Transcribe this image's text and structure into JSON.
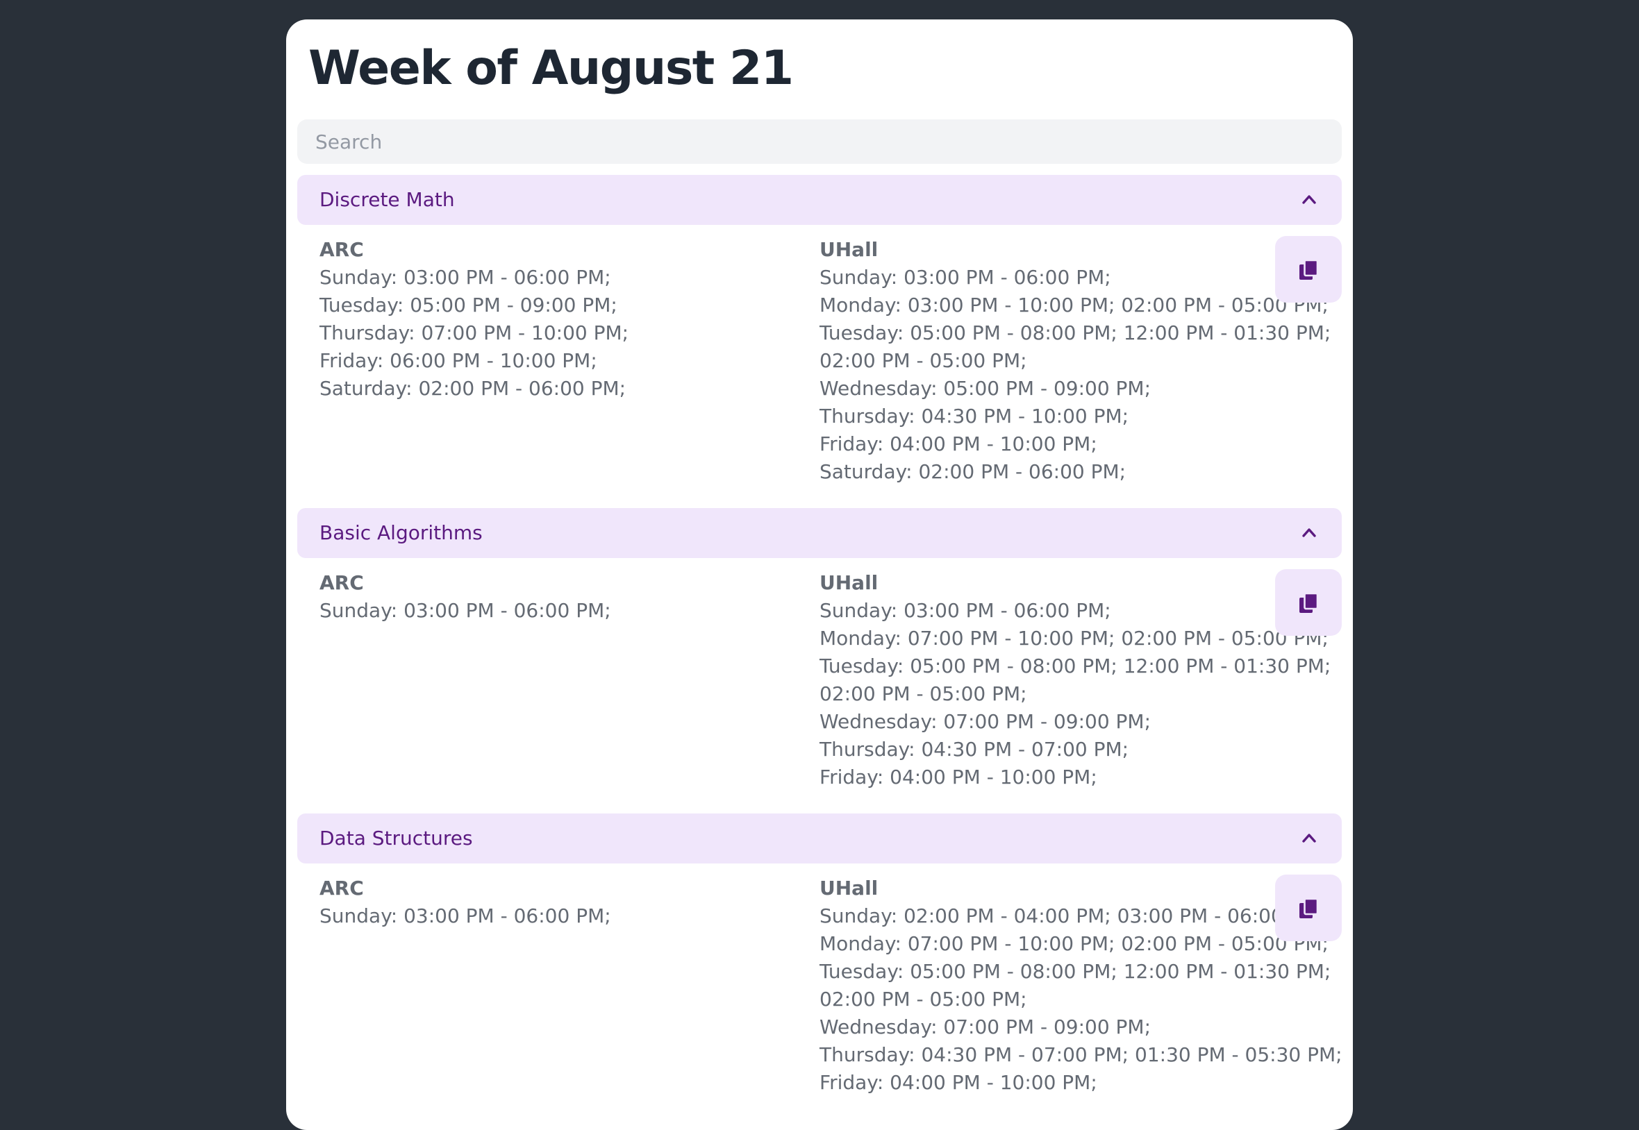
{
  "page": {
    "title": "Week of August 21",
    "search_placeholder": "Search"
  },
  "colors": {
    "background": "#293039",
    "card": "#ffffff",
    "accent": "#5b1a80",
    "accent_soft": "#f0e6fb",
    "text": "#646a73",
    "title": "#1e2733"
  },
  "icons": {
    "copy": "copy-icon",
    "collapse": "chevron-up-icon"
  },
  "courses": [
    {
      "name": "Discrete Math",
      "arc": {
        "label": "ARC",
        "lines": [
          "Sunday: 03:00 PM - 06:00 PM;",
          "Tuesday: 05:00 PM - 09:00 PM;",
          "Thursday: 07:00 PM - 10:00 PM;",
          "Friday: 06:00 PM - 10:00 PM;",
          "Saturday: 02:00 PM - 06:00 PM;"
        ]
      },
      "uhall": {
        "label": "UHall",
        "lines": [
          "Sunday: 03:00 PM - 06:00 PM;",
          "Monday: 03:00 PM - 10:00 PM; 02:00 PM - 05:00 PM;",
          "Tuesday: 05:00 PM - 08:00 PM; 12:00 PM - 01:30 PM;",
          "02:00 PM - 05:00 PM;",
          "Wednesday: 05:00 PM - 09:00 PM;",
          "Thursday: 04:30 PM - 10:00 PM;",
          "Friday: 04:00 PM - 10:00 PM;",
          "Saturday: 02:00 PM - 06:00 PM;"
        ]
      }
    },
    {
      "name": "Basic Algorithms",
      "arc": {
        "label": "ARC",
        "lines": [
          "Sunday: 03:00 PM - 06:00 PM;"
        ]
      },
      "uhall": {
        "label": "UHall",
        "lines": [
          "Sunday: 03:00 PM - 06:00 PM;",
          "Monday: 07:00 PM - 10:00 PM; 02:00 PM - 05:00 PM;",
          "Tuesday: 05:00 PM - 08:00 PM; 12:00 PM - 01:30 PM;",
          "02:00 PM - 05:00 PM;",
          "Wednesday: 07:00 PM - 09:00 PM;",
          "Thursday: 04:30 PM - 07:00 PM;",
          "Friday: 04:00 PM - 10:00 PM;"
        ]
      }
    },
    {
      "name": "Data Structures",
      "arc": {
        "label": "ARC",
        "lines": [
          "Sunday: 03:00 PM - 06:00 PM;"
        ]
      },
      "uhall": {
        "label": "UHall",
        "lines": [
          "Sunday: 02:00 PM - 04:00 PM; 03:00 PM - 06:00 PM;",
          "Monday: 07:00 PM - 10:00 PM; 02:00 PM - 05:00 PM;",
          "Tuesday: 05:00 PM - 08:00 PM; 12:00 PM - 01:30 PM;",
          "02:00 PM - 05:00 PM;",
          "Wednesday: 07:00 PM - 09:00 PM;",
          "Thursday: 04:30 PM - 07:00 PM; 01:30 PM - 05:30 PM;",
          "Friday: 04:00 PM - 10:00 PM;"
        ]
      }
    }
  ]
}
